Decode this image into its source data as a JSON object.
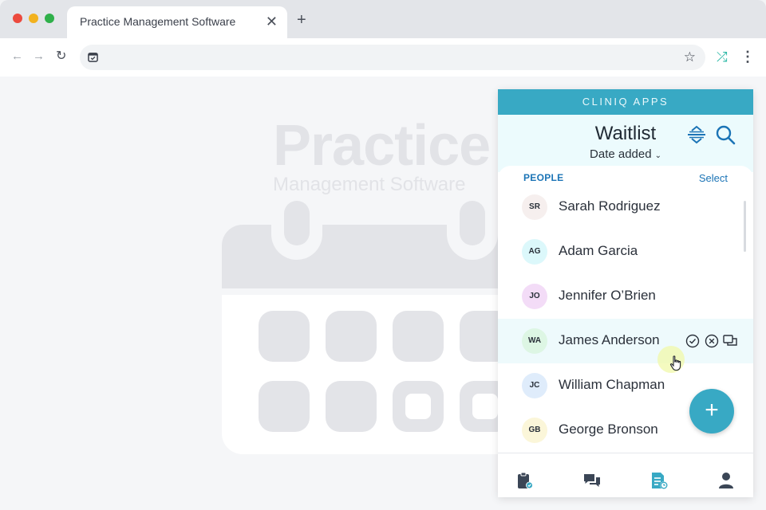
{
  "browser": {
    "tab_title": "Practice Management Software",
    "close_glyph": "✕",
    "new_tab_glyph": "+",
    "back_glyph": "←",
    "forward_glyph": "→",
    "reload_glyph": "↻",
    "star_glyph": "☆",
    "extension_glyph": "⤮",
    "menu_glyph": "⋮"
  },
  "background_page": {
    "title": "Practice",
    "subtitle": "Management Software"
  },
  "panel": {
    "brand": "CLINIQ APPS",
    "title": "Waitlist",
    "sort_label": "Date added",
    "sort_chevron": "⌄",
    "people_label": "PEOPLE",
    "select_label": "Select",
    "fab_label": "+",
    "colors": {
      "accent": "#38a9c4",
      "link": "#1b74b6",
      "header_bg": "#ecfbfd"
    },
    "people": [
      {
        "initials": "SR",
        "name": "Sarah Rodriguez",
        "color": "#f6efee"
      },
      {
        "initials": "AG",
        "name": "Adam Garcia",
        "color": "#dcf8fb"
      },
      {
        "initials": "JO",
        "name": "Jennifer O’Brien",
        "color": "#f3dcf7"
      },
      {
        "initials": "WA",
        "name": "James Anderson",
        "color": "#ddf6e4"
      },
      {
        "initials": "JC",
        "name": "William Chapman",
        "color": "#dfecfb"
      },
      {
        "initials": "GB",
        "name": "George Bronson",
        "color": "#fbf6d9"
      }
    ],
    "row_actions": [
      "check-circle-icon",
      "x-circle-icon",
      "message-icon"
    ],
    "bottom_nav": [
      "clipboard-check-icon",
      "chat-icon",
      "waitlist-doc-icon",
      "profile-icon"
    ]
  }
}
